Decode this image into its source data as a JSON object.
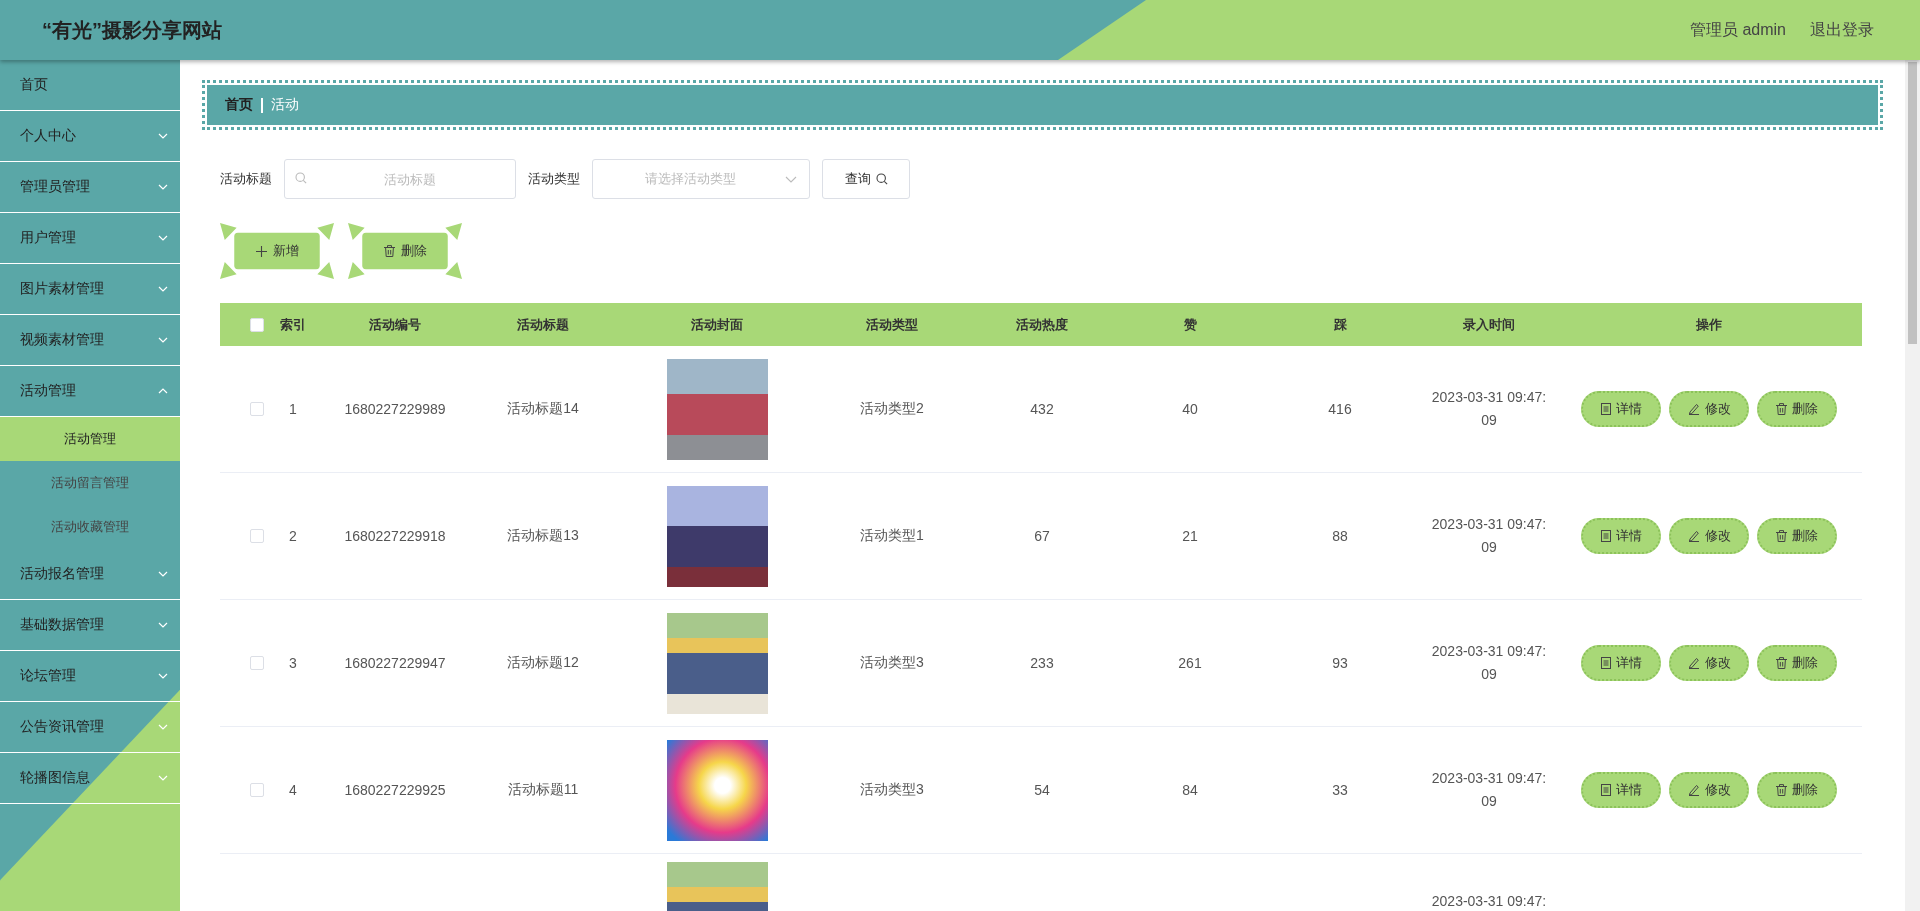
{
  "header": {
    "title": "“有光”摄影分享网站",
    "user": "管理员 admin",
    "logout": "退出登录"
  },
  "sidebar": {
    "items": [
      {
        "label": "首页",
        "kind": "link"
      },
      {
        "label": "个人中心",
        "kind": "menu",
        "expanded": false
      },
      {
        "label": "管理员管理",
        "kind": "menu",
        "expanded": false
      },
      {
        "label": "用户管理",
        "kind": "menu",
        "expanded": false
      },
      {
        "label": "图片素材管理",
        "kind": "menu",
        "expanded": false
      },
      {
        "label": "视频素材管理",
        "kind": "menu",
        "expanded": false
      },
      {
        "label": "活动管理",
        "kind": "menu",
        "expanded": true,
        "children": [
          {
            "label": "活动管理",
            "selected": true
          },
          {
            "label": "活动留言管理",
            "selected": false
          },
          {
            "label": "活动收藏管理",
            "selected": false
          }
        ]
      },
      {
        "label": "活动报名管理",
        "kind": "menu",
        "expanded": false
      },
      {
        "label": "基础数据管理",
        "kind": "menu",
        "expanded": false
      },
      {
        "label": "论坛管理",
        "kind": "menu",
        "expanded": false
      },
      {
        "label": "公告资讯管理",
        "kind": "menu",
        "expanded": false
      },
      {
        "label": "轮播图信息",
        "kind": "menu",
        "expanded": false
      }
    ]
  },
  "breadcrumb": [
    "首页",
    "活动"
  ],
  "filters": [
    {
      "label": "活动标题",
      "kind": "text",
      "placeholder": "活动标题"
    },
    {
      "label": "活动类型",
      "kind": "select",
      "placeholder": "请选择活动类型"
    }
  ],
  "search_button": "查询",
  "toolbar": [
    {
      "label": "新增",
      "kind": "add"
    },
    {
      "label": "删除",
      "kind": "delete"
    }
  ],
  "table": {
    "all_checked": false,
    "columns": [
      "索引",
      "活动编号",
      "活动标题",
      "活动封面",
      "活动类型",
      "活动热度",
      "赞",
      "踩",
      "录入时间",
      "操作"
    ],
    "rows": [
      {
        "checked": false,
        "index": "1",
        "code": "1680227229989",
        "title": "活动标题14",
        "type": "活动类型2",
        "heat": "432",
        "likes": "40",
        "dislikes": "416",
        "time": "2023-03-31 09:47:09",
        "actions": [
          "详情",
          "修改",
          "删除"
        ]
      },
      {
        "checked": false,
        "index": "2",
        "code": "1680227229918",
        "title": "活动标题13",
        "type": "活动类型1",
        "heat": "67",
        "likes": "21",
        "dislikes": "88",
        "time": "2023-03-31 09:47:09",
        "actions": [
          "详情",
          "修改",
          "删除"
        ]
      },
      {
        "checked": false,
        "index": "3",
        "code": "1680227229947",
        "title": "活动标题12",
        "type": "活动类型3",
        "heat": "233",
        "likes": "261",
        "dislikes": "93",
        "time": "2023-03-31 09:47:09",
        "actions": [
          "详情",
          "修改",
          "删除"
        ]
      },
      {
        "checked": false,
        "index": "4",
        "code": "1680227229925",
        "title": "活动标题11",
        "type": "活动类型3",
        "heat": "54",
        "likes": "84",
        "dislikes": "33",
        "time": "2023-03-31 09:47:09",
        "actions": [
          "详情",
          "修改",
          "删除"
        ]
      }
    ],
    "partial_row": {
      "time": "2023-03-31 09:47:"
    }
  }
}
